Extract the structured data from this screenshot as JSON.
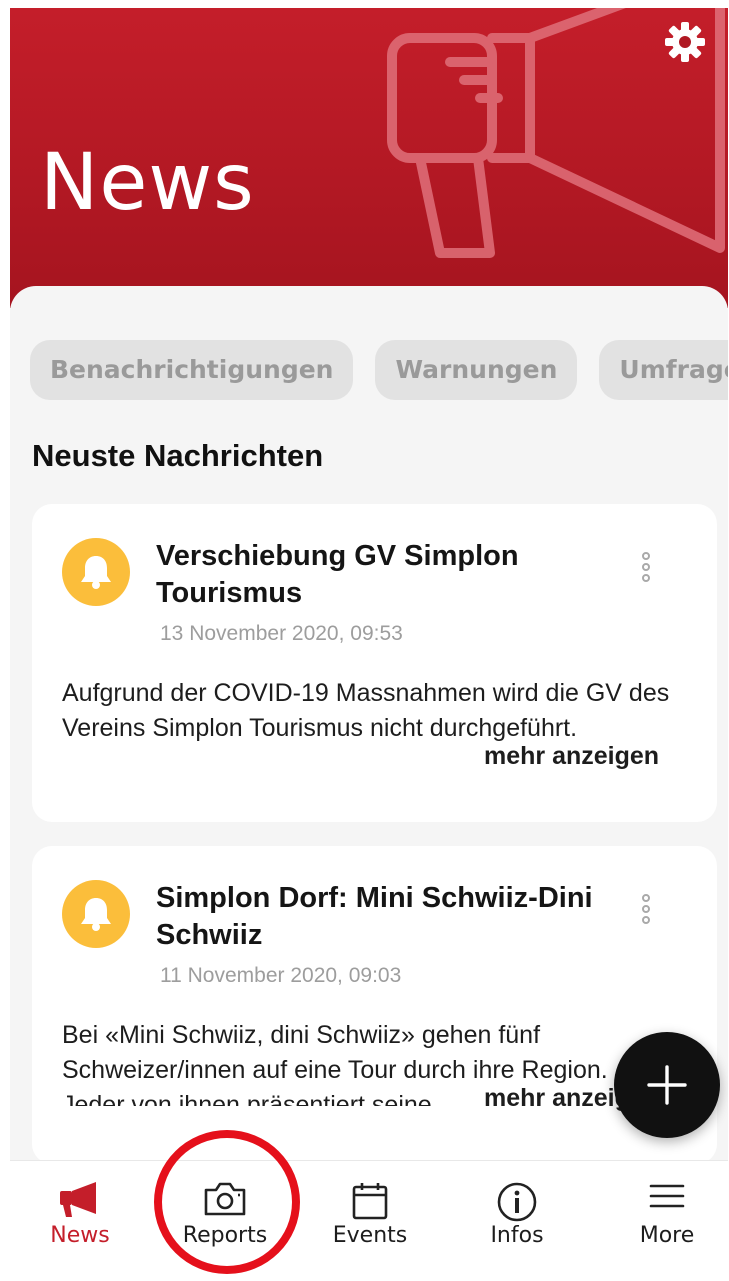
{
  "header": {
    "title": "News",
    "settings_icon": "gear-icon",
    "background_icon": "megaphone-icon"
  },
  "filters": [
    "Benachrichtigungen",
    "Warnungen",
    "Umfragen"
  ],
  "section_title": "Neuste Nachrichten",
  "posts": [
    {
      "icon": "bell-icon",
      "title": "Verschiebung GV Simplon Tourismus",
      "date": "13 November 2020, 09:53",
      "body": "Aufgrund der COVID-19 Massnahmen wird die GV des Vereins Simplon Tourismus nicht durchgeführt.",
      "more": "mehr anzeigen"
    },
    {
      "icon": "bell-icon",
      "title": "Simplon Dorf: Mini Schwiiz-Dini Schwiiz",
      "date": "11 November 2020, 09:03",
      "body": "Bei «Mini Schwiiz, dini Schwiiz» gehen fünf Schweizer/innen auf eine Tour durch ihre Region. Jeder von ihnen präsentiert seine",
      "more": "mehr anzeigen"
    }
  ],
  "fab_icon": "plus-icon",
  "nav": [
    {
      "label": "News",
      "icon": "megaphone-icon",
      "active": true
    },
    {
      "label": "Reports",
      "icon": "camera-icon",
      "active": false
    },
    {
      "label": "Events",
      "icon": "calendar-icon",
      "active": false
    },
    {
      "label": "Infos",
      "icon": "info-icon",
      "active": false
    },
    {
      "label": "More",
      "icon": "menu-icon",
      "active": false
    }
  ],
  "colors": {
    "brand_red": "#c41e2a",
    "bell_yellow": "#fbbe3b",
    "annotation_red": "#e5101b"
  }
}
